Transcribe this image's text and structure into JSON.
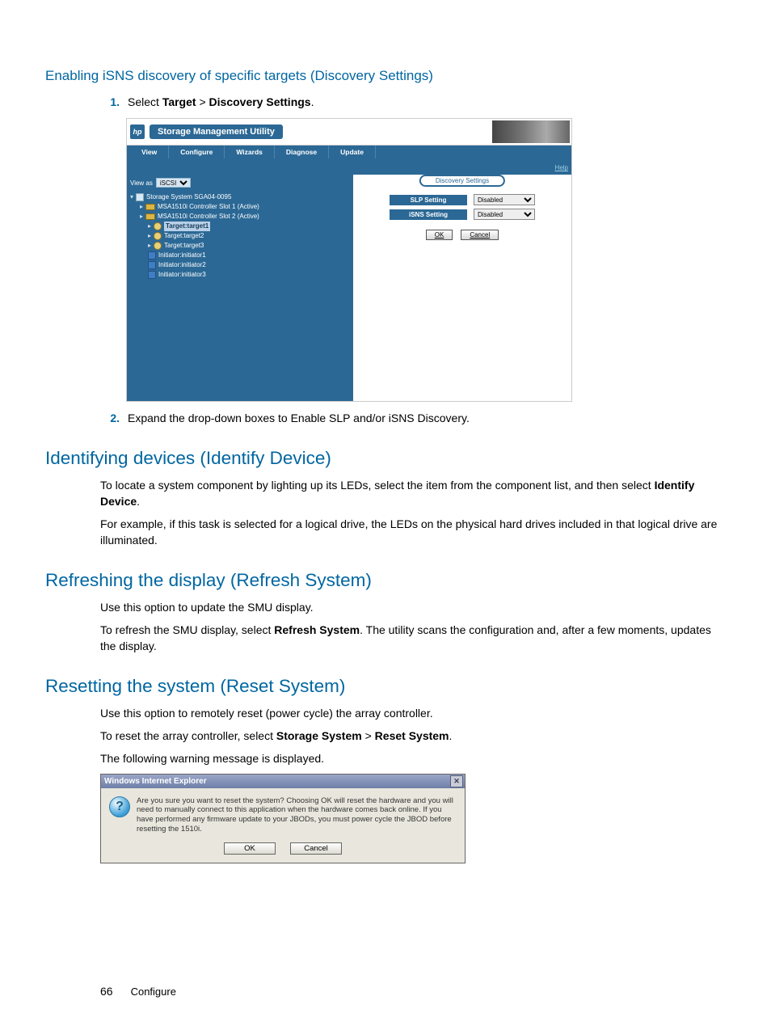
{
  "sections": {
    "enabling": {
      "heading": "Enabling iSNS discovery of specific targets (Discovery Settings)",
      "step1_prefix": "Select ",
      "step1_b1": "Target",
      "step1_gt": " > ",
      "step1_b2": "Discovery Settings",
      "step1_suffix": ".",
      "step2": "Expand the drop-down boxes to Enable SLP and/or iSNS Discovery."
    },
    "identifying": {
      "heading": "Identifying devices (Identify Device)",
      "p1_a": "To locate a system component by lighting up its LEDs, select the item from the component list, and then select ",
      "p1_b": "Identify Device",
      "p1_c": ".",
      "p2": "For example, if this task is selected for a logical drive, the LEDs on the physical hard drives included in that logical drive are illuminated."
    },
    "refreshing": {
      "heading": "Refreshing the display (Refresh System)",
      "p1": "Use this option to update the SMU display.",
      "p2_a": "To refresh the SMU display, select ",
      "p2_b": "Refresh System",
      "p2_c": ". The utility scans the configuration and, after a few moments, updates the display."
    },
    "resetting": {
      "heading": "Resetting the system (Reset System)",
      "p1": "Use this option to remotely reset (power cycle) the array controller.",
      "p2_a": "To reset the array controller, select ",
      "p2_b": "Storage System",
      "p2_mid": " > ",
      "p2_c": "Reset System",
      "p2_d": ".",
      "p3": "The following warning message is displayed."
    }
  },
  "steps": {
    "n1": "1.",
    "n2": "2."
  },
  "smu": {
    "logo": "hp",
    "title": "Storage Management Utility",
    "menu": [
      "View",
      "Configure",
      "Wizards",
      "Diagnose",
      "Update"
    ],
    "help": "Help",
    "view_as_label": "View as",
    "view_as_value": "iSCSI",
    "tree": {
      "system": "Storage System SGA04-0095",
      "ctrl1": "MSA1510i Controller Slot 1 (Active)",
      "ctrl2": "MSA1510i Controller Slot 2 (Active)",
      "t1": "Target:target1",
      "t2": "Target:target2",
      "t3": "Target:target3",
      "i1": "Initiator:initiator1",
      "i2": "Initiator:initiator2",
      "i3": "Initiator:initiator3"
    },
    "panel": {
      "title": "Discovery Settings",
      "slp_label": "SLP Setting",
      "isns_label": "iSNS Setting",
      "value_disabled": "Disabled",
      "ok": "OK",
      "cancel": "Cancel"
    }
  },
  "ie_dialog": {
    "title": "Windows Internet Explorer",
    "qmark": "?",
    "message": "Are you sure you want to reset the system? Choosing OK will reset the hardware and you will need to manually connect to this application when the hardware comes back online. If you have performed any firmware update to your JBODs, you must power cycle the JBOD before resetting the 1510i.",
    "ok": "OK",
    "cancel": "Cancel",
    "close": "✕"
  },
  "footer": {
    "page": "66",
    "section": "Configure"
  }
}
